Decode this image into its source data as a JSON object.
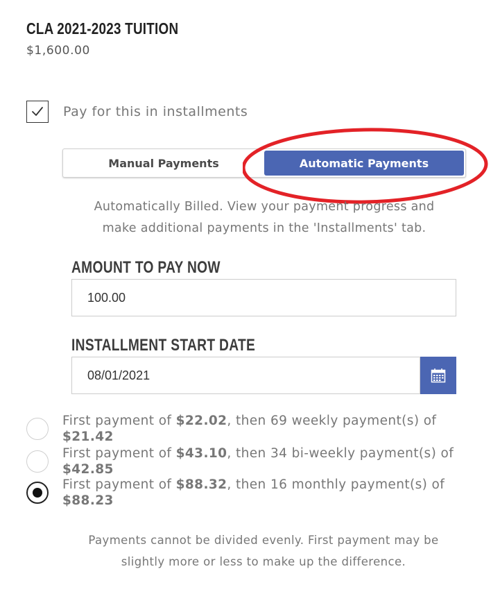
{
  "item": {
    "title": "CLA 2021-2023 TUITION",
    "price": "$1,600.00"
  },
  "installments": {
    "checkbox_label": "Pay for this in installments",
    "checked": true
  },
  "payment_mode": {
    "manual_label": "Manual Payments",
    "automatic_label": "Automatic Payments",
    "selected": "Automatic Payments"
  },
  "description": {
    "line1": "Automatically Billed. View your payment progress and",
    "line2": "make additional payments in the 'Installments' tab."
  },
  "amount": {
    "label": "AMOUNT TO PAY NOW",
    "value": "100.00"
  },
  "start_date": {
    "label": "INSTALLMENT START DATE",
    "value": "08/01/2021",
    "calendar_icon": "calendar-icon"
  },
  "plans": [
    {
      "prefix": "First payment of ",
      "first": "$22.02",
      "middle": ", then 69 weekly payment(s) of ",
      "recurring": "$21.42",
      "selected": false
    },
    {
      "prefix": "First payment of ",
      "first": "$43.10",
      "middle": ", then 34 bi-weekly payment(s) of ",
      "recurring": "$42.85",
      "selected": false
    },
    {
      "prefix": "First payment of ",
      "first": "$88.32",
      "middle": ", then 16 monthly payment(s) of ",
      "recurring": "$88.23",
      "selected": true
    }
  ],
  "note": {
    "line1": "Payments cannot be divided evenly. First payment may be",
    "line2": "slightly more or less to make up the difference."
  },
  "colors": {
    "accent": "#4b66b3",
    "annotation": "#e32227"
  }
}
